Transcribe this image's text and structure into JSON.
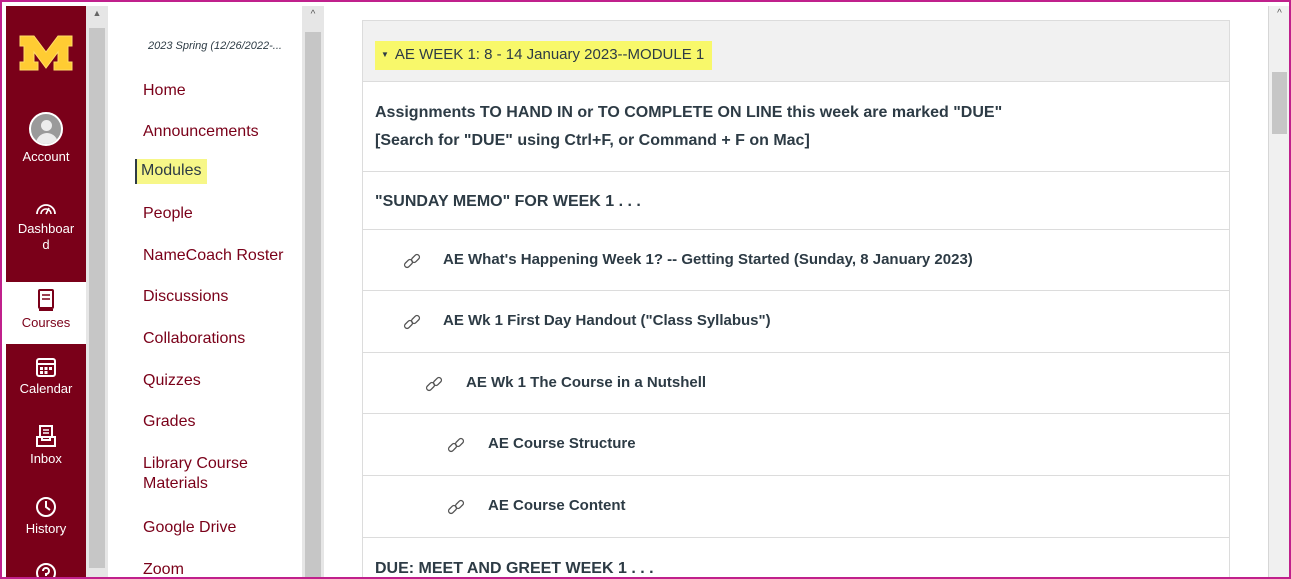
{
  "global_nav": {
    "items": [
      {
        "label": "Account",
        "icon": "account-avatar-icon"
      },
      {
        "label": "Dashboard",
        "icon": "dashboard-icon"
      },
      {
        "label": "Courses",
        "icon": "courses-icon",
        "active": true
      },
      {
        "label": "Calendar",
        "icon": "calendar-icon"
      },
      {
        "label": "Inbox",
        "icon": "inbox-icon"
      },
      {
        "label": "History",
        "icon": "history-icon"
      }
    ],
    "account_label": "Account",
    "dashboard_label_1": "Dashboar",
    "dashboard_label_2": "d",
    "courses_label": "Courses",
    "calendar_label": "Calendar",
    "inbox_label": "Inbox",
    "history_label": "History",
    "brand_color": "#7a0019",
    "logo_color": "#ffcc33"
  },
  "course_nav": {
    "term": "2023 Spring (12/26/2022-...",
    "links": [
      "Home",
      "Announcements",
      "Modules",
      "People",
      "NameCoach Roster",
      "Discussions",
      "Collaborations",
      "Quizzes",
      "Grades",
      "Library Course",
      "Materials",
      "Google Drive",
      "Zoom"
    ],
    "active": "Modules",
    "highlight_color": "#f7f788"
  },
  "module": {
    "title": "AE WEEK 1: 8 - 14 January 2023--MODULE 1",
    "rows": {
      "intro_line1": "Assignments TO HAND IN or TO COMPLETE ON LINE this week are marked \"DUE\"",
      "intro_line2": "[Search for \"DUE\" using Ctrl+F, or Command + F on Mac]",
      "sunday_memo": "\"SUNDAY MEMO\" FOR WEEK 1 . . .",
      "item1": "AE What's Happening Week 1? -- Getting Started (Sunday, 8 January 2023)",
      "item2": "AE Wk 1 First Day Handout (\"Class Syllabus\")",
      "item3": "AE Wk 1 The Course in a Nutshell",
      "item4": "AE Course Structure",
      "item5": "AE Course Content",
      "due": "DUE: MEET AND GREET WEEK 1 . . ."
    }
  }
}
